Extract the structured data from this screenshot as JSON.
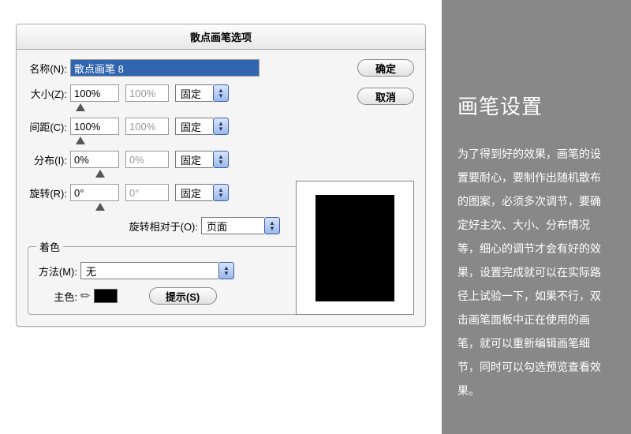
{
  "dialog": {
    "title": "散点画笔选项",
    "ok": "确定",
    "cancel": "取消",
    "name_label": "名称(N):",
    "name_value": "散点画笔 8",
    "rows": [
      {
        "label": "大小(Z):",
        "v1": "100%",
        "v2": "100%",
        "mode": "固定"
      },
      {
        "label": "间距(C):",
        "v1": "100%",
        "v2": "100%",
        "mode": "固定"
      },
      {
        "label": "分布(I):",
        "v1": "0%",
        "v2": "0%",
        "mode": "固定"
      },
      {
        "label": "旋转(R):",
        "v1": "0°",
        "v2": "0°",
        "mode": "固定"
      }
    ],
    "rot_rel_label": "旋转相对于(O):",
    "rot_rel_value": "页面",
    "color_legend": "着色",
    "method_label": "方法(M):",
    "method_value": "无",
    "key_label": "主色:",
    "hint": "提示(S)"
  },
  "side": {
    "heading": "画笔设置",
    "body": "为了得到好的效果，画笔的设置要耐心，要制作出随机散布的图案，必须多次调节，要确定好主次、大小、分布情况等，细心的调节才会有好的效果，设置完成就可以在实际路径上试验一下，如果不行，双击画笔面板中正在使用的画笔，就可以重新编辑画笔细节，同时可以勾选预览查看效果。"
  }
}
